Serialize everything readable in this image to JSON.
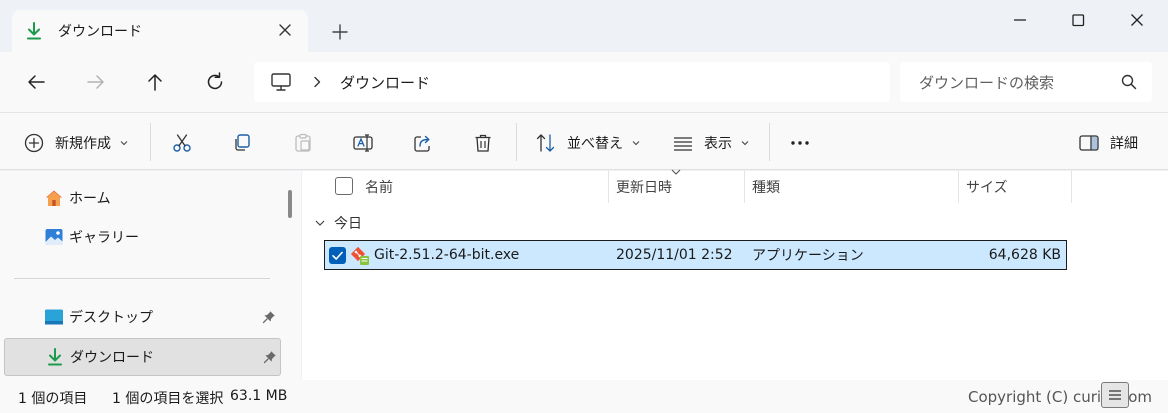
{
  "window": {
    "tab_label": "ダウンロード",
    "colors": {
      "accent": "#005fb8",
      "download_green": "#1a9c4b",
      "selection": "#cce8ff"
    }
  },
  "address": {
    "breadcrumb": "ダウンロード",
    "search_placeholder": "ダウンロードの検索"
  },
  "toolbar": {
    "new_label": "新規作成",
    "sort_label": "並べ替え",
    "view_label": "表示",
    "details_label": "詳細"
  },
  "sidebar": {
    "items": [
      {
        "label": "ホーム",
        "icon": "home-icon"
      },
      {
        "label": "ギャラリー",
        "icon": "gallery-icon"
      },
      {
        "label": "デスクトップ",
        "icon": "desktop-icon",
        "pinned": true
      },
      {
        "label": "ダウンロード",
        "icon": "download-icon",
        "pinned": true,
        "selected": true
      }
    ]
  },
  "list": {
    "columns": [
      "名前",
      "更新日時",
      "種類",
      "サイズ"
    ],
    "group_label": "今日",
    "files": [
      {
        "name": "Git-2.51.2-64-bit.exe",
        "modified": "2025/11/01 2:52",
        "type": "アプリケーション",
        "size": "64,628 KB",
        "selected": true
      }
    ]
  },
  "status": {
    "item_count": "1 個の項目",
    "selected_count": "1 個の項目を選択",
    "selected_size": "63.1 MB",
    "watermark": "Copyright (C) curict.com"
  }
}
